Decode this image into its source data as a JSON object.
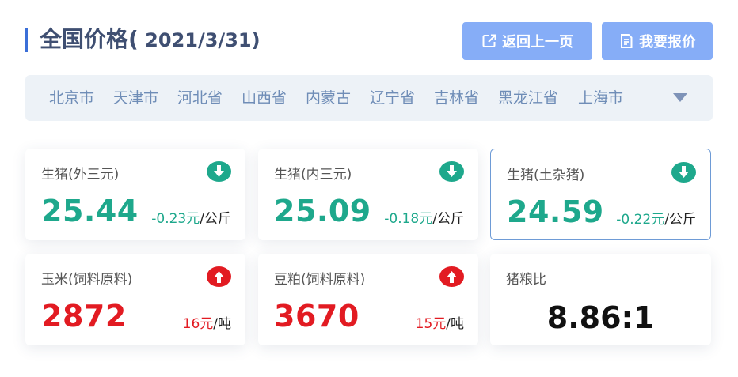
{
  "header": {
    "title": "全国价格(",
    "date": " 2021/3/31)",
    "back_label": "返回上一页",
    "report_label": "我要报价"
  },
  "regions": [
    "北京市",
    "天津市",
    "河北省",
    "山西省",
    "内蒙古",
    "辽宁省",
    "吉林省",
    "黑龙江省",
    "上海市"
  ],
  "cards": [
    {
      "name": "生猪(外三元)",
      "value": "25.44",
      "change": "-0.23元",
      "unit": "/公斤",
      "trend": "down"
    },
    {
      "name": "生猪(内三元)",
      "value": "25.09",
      "change": "-0.18元",
      "unit": "/公斤",
      "trend": "down"
    },
    {
      "name": "生猪(土杂猪)",
      "value": "24.59",
      "change": "-0.22元",
      "unit": "/公斤",
      "trend": "down"
    },
    {
      "name": "玉米(饲料原料)",
      "value": "2872",
      "change": "16元",
      "unit": "/吨",
      "trend": "up"
    },
    {
      "name": "豆粕(饲料原料)",
      "value": "3670",
      "change": "15元",
      "unit": "/吨",
      "trend": "up"
    },
    {
      "name": "猪粮比",
      "value": "8.86:1"
    }
  ],
  "colors": {
    "down": "#1ea88c",
    "up": "#e21b22",
    "accent": "#3b6fd8",
    "button": "#86adf7"
  },
  "icons": {
    "down": "arrow-down-circle-icon",
    "up": "arrow-up-circle-icon",
    "back": "external-link-icon",
    "report": "document-icon",
    "toggle": "triangle-down-icon"
  }
}
